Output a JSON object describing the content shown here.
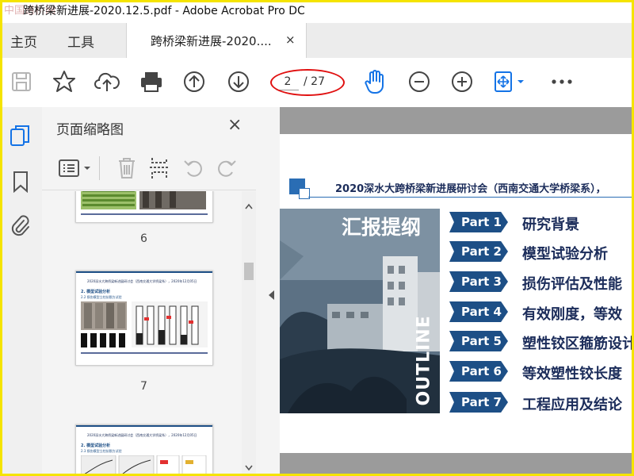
{
  "window": {
    "title": "跨桥梁新进展-2020.12.5.pdf - Adobe Acrobat Pro DC",
    "watermark": "中国道桥网"
  },
  "menu": {
    "home": "主页",
    "tools": "工具"
  },
  "tab": {
    "label": "跨桥梁新进展-2020....",
    "close": "×"
  },
  "toolbar": {
    "icons": [
      "save-icon",
      "bookmark-star-icon",
      "cloud-upload-icon",
      "print-icon",
      "page-up-icon",
      "page-down-icon",
      "hand-tool-icon",
      "zoom-out-icon",
      "zoom-in-icon",
      "fit-page-icon",
      "more-icon"
    ],
    "page_current": "2",
    "page_total": "/ 27"
  },
  "panel": {
    "title": "页面缩略图",
    "close": "×",
    "pages": [
      "6",
      "7"
    ],
    "thumb7": {
      "header": "2020深水大跨桥梁新进展研讨会（西南交通大学桥梁系），2020年12月05日",
      "section": "2. 模型试验分析",
      "subsection": "2.2 损伤模型立柱抗裂方试验"
    },
    "thumb8": {
      "header": "2020深水大跨桥梁新进展研讨会（西南交通大学桥梁系），2020年12月05日",
      "section": "2. 模型试验分析",
      "subsection": "2.3 损伤模型立柱抗裂方试验"
    }
  },
  "slide": {
    "header": "2020深水大跨桥梁新进展研讨会（西南交通大学桥梁系），",
    "outline_title": "汇报提纲",
    "outline_vertical": "OUTLINE",
    "parts": [
      {
        "label": "Part 1",
        "text": "研究背景"
      },
      {
        "label": "Part 2",
        "text": "模型试验分析"
      },
      {
        "label": "Part 3",
        "text": "损伤评估及性能"
      },
      {
        "label": "Part 4",
        "text": "有效刚度，等效"
      },
      {
        "label": "Part 5",
        "text": "塑性铰区箍筋设计"
      },
      {
        "label": "Part 6",
        "text": "等效塑性铰长度"
      },
      {
        "label": "Part 7",
        "text": "工程应用及结论"
      }
    ]
  },
  "colors": {
    "accent": "#1d4f86",
    "annotation": "#e01010",
    "frame": "#f5e400"
  }
}
